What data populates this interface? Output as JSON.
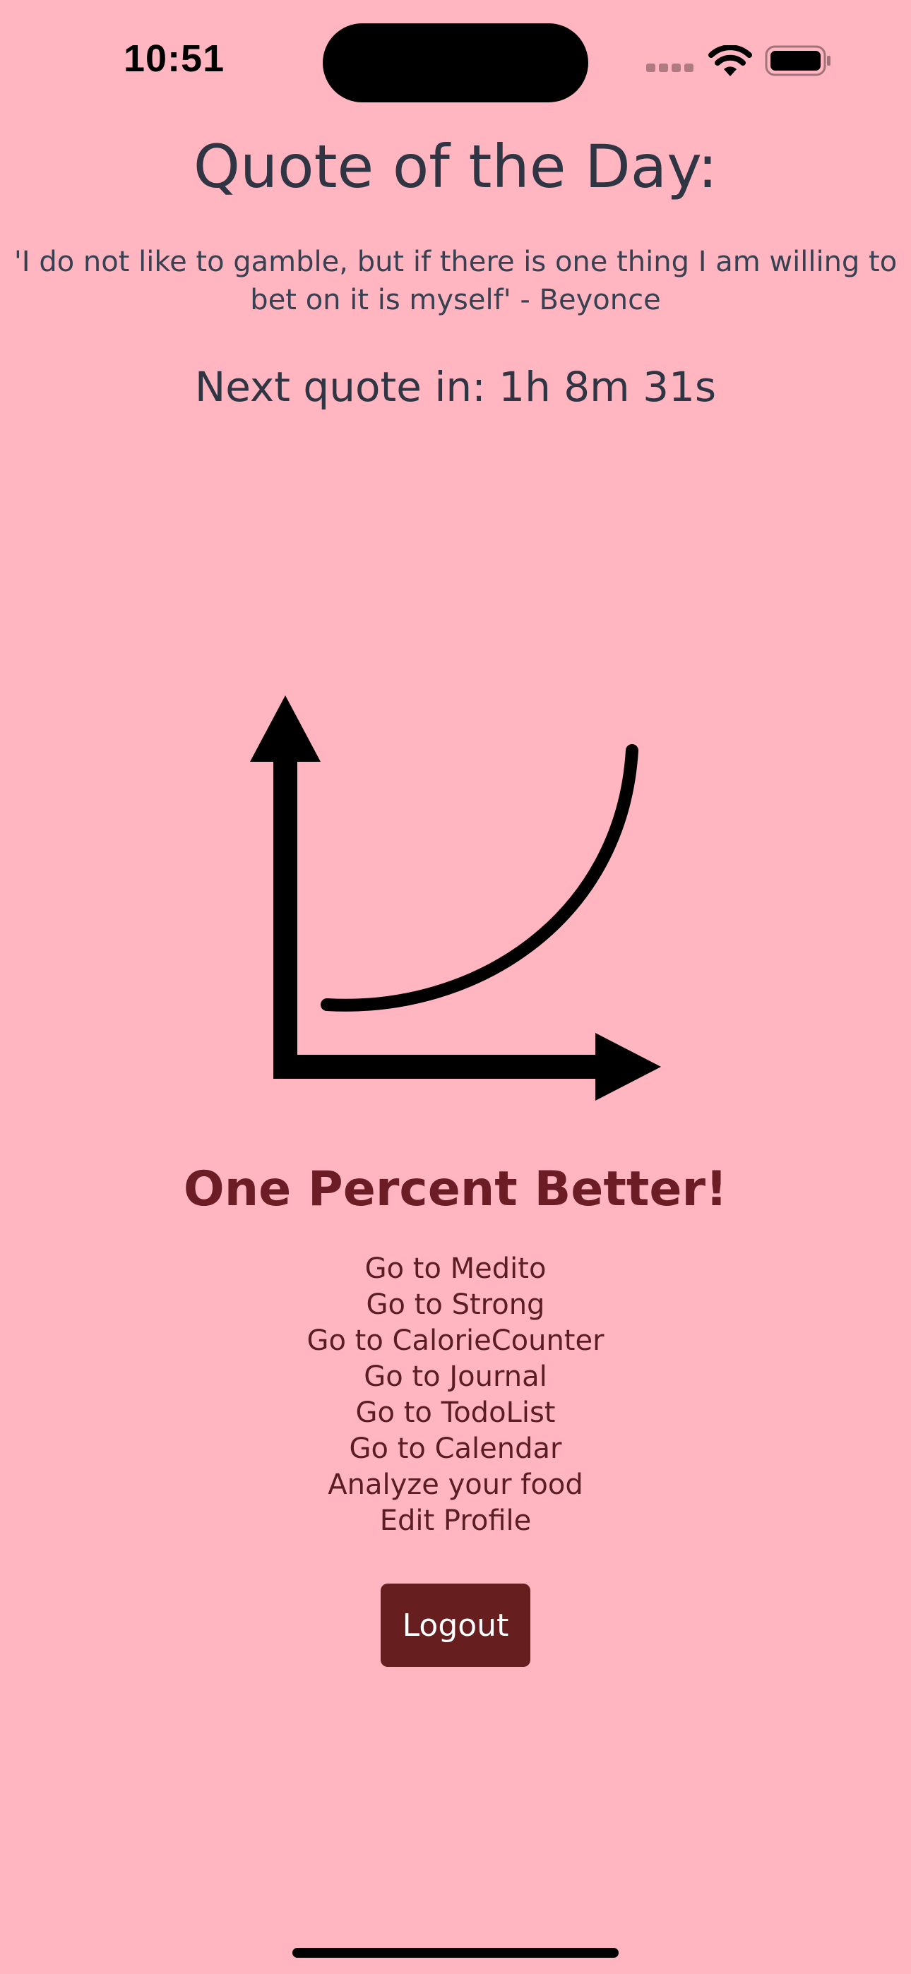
{
  "status_bar": {
    "time": "10:51",
    "icons": [
      "cellular-signal-icon",
      "wifi-icon",
      "battery-icon"
    ]
  },
  "quote": {
    "heading": "Quote of the Day:",
    "text": "'I do not like to gamble, but if there is one thing I am willing to bet on it is myself' - Beyonce",
    "countdown": "Next quote in: 1h 8m 31s"
  },
  "logo": {
    "icon": "exponential-growth-graph-icon"
  },
  "brand": {
    "title": "One Percent Better!"
  },
  "nav": {
    "items": [
      "Go to Medito",
      "Go to Strong",
      "Go to CalorieCounter",
      "Go to Journal",
      "Go to TodoList",
      "Go to Calendar",
      "Analyze your food",
      "Edit Profile"
    ]
  },
  "actions": {
    "logout_label": "Logout"
  },
  "colors": {
    "background": "#FFB6C1",
    "accent": "#661E1E",
    "text": "#2F3542"
  }
}
